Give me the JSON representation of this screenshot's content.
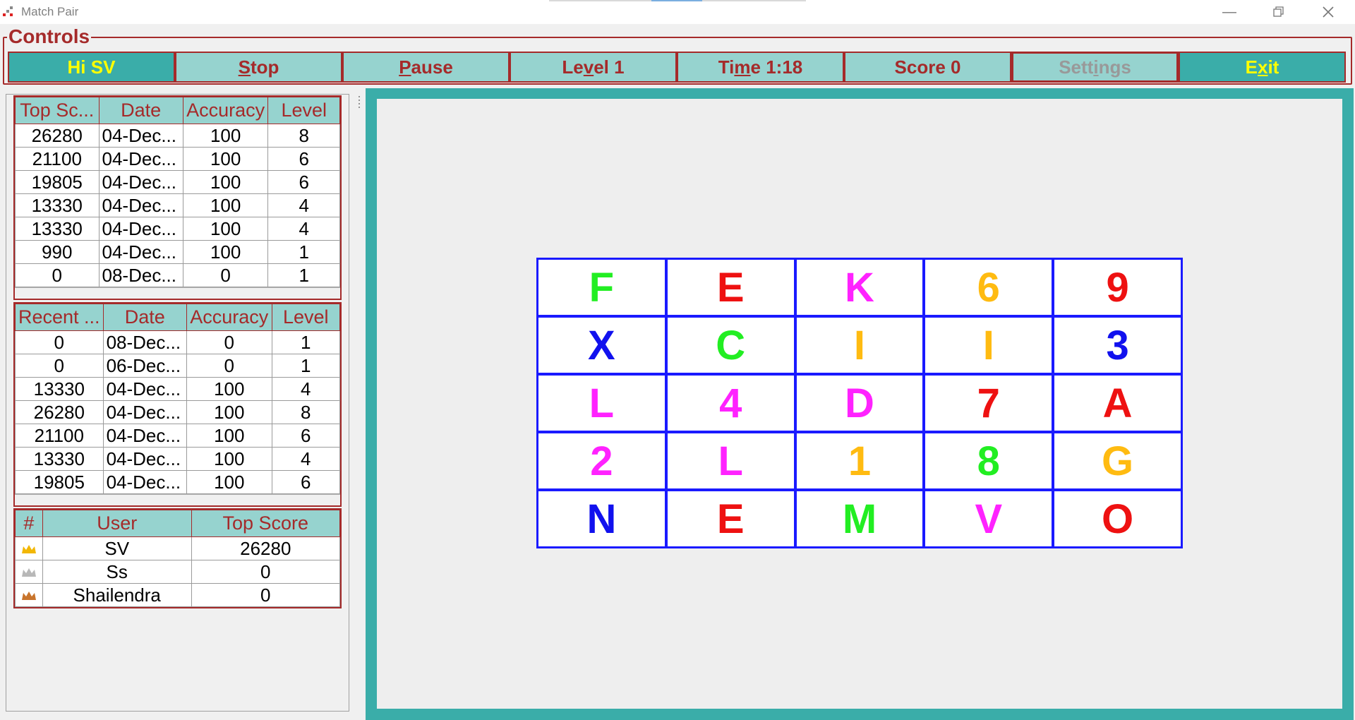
{
  "window": {
    "title": "Match Pair",
    "minimize_icon": "minimize-icon",
    "restore_icon": "restore-icon",
    "close_icon": "close-icon"
  },
  "controls": {
    "legend": "Controls",
    "buttons": [
      {
        "label": "Hi SV",
        "style": "teal"
      },
      {
        "label": "Stop",
        "style": "normal"
      },
      {
        "label": "Pause",
        "style": "normal"
      },
      {
        "label": "Level 1",
        "style": "normal"
      },
      {
        "label": "Time 1:18",
        "style": "normal"
      },
      {
        "label": "Score 0",
        "style": "normal"
      },
      {
        "label": "Settings",
        "style": "disabled"
      },
      {
        "label": "Exit",
        "style": "teal"
      }
    ]
  },
  "top_scores": {
    "headers": [
      "Top Sc...",
      "Date",
      "Accuracy",
      "Level"
    ],
    "rows": [
      [
        "26280",
        "04-Dec...",
        "100",
        "8"
      ],
      [
        "21100",
        "04-Dec...",
        "100",
        "6"
      ],
      [
        "19805",
        "04-Dec...",
        "100",
        "6"
      ],
      [
        "13330",
        "04-Dec...",
        "100",
        "4"
      ],
      [
        "13330",
        "04-Dec...",
        "100",
        "4"
      ],
      [
        "990",
        "04-Dec...",
        "100",
        "1"
      ],
      [
        "0",
        "08-Dec...",
        "0",
        "1"
      ]
    ]
  },
  "recent_scores": {
    "headers": [
      "Recent ...",
      "Date",
      "Accuracy",
      "Level"
    ],
    "rows": [
      [
        "0",
        "08-Dec...",
        "0",
        "1"
      ],
      [
        "0",
        "06-Dec...",
        "0",
        "1"
      ],
      [
        "13330",
        "04-Dec...",
        "100",
        "4"
      ],
      [
        "26280",
        "04-Dec...",
        "100",
        "8"
      ],
      [
        "21100",
        "04-Dec...",
        "100",
        "6"
      ],
      [
        "13330",
        "04-Dec...",
        "100",
        "4"
      ],
      [
        "19805",
        "04-Dec...",
        "100",
        "6"
      ]
    ]
  },
  "users": {
    "headers": [
      "#",
      "User",
      "Top Score"
    ],
    "rows": [
      {
        "crown": "gold-crown-icon",
        "crown_color": "#f2b705",
        "user": "SV",
        "score": "26280"
      },
      {
        "crown": "silver-crown-icon",
        "crown_color": "#b8b8b8",
        "user": "Ss",
        "score": "0"
      },
      {
        "crown": "bronze-crown-icon",
        "crown_color": "#c8742c",
        "user": "Shailendra",
        "score": "0"
      }
    ]
  },
  "board": {
    "accent": "#3aada9",
    "tiles": [
      {
        "ch": "F",
        "color": "#22ee22"
      },
      {
        "ch": "E",
        "color": "#ee1111"
      },
      {
        "ch": "K",
        "color": "#ff22ff"
      },
      {
        "ch": "6",
        "color": "#ffbb11"
      },
      {
        "ch": "9",
        "color": "#ee1111"
      },
      {
        "ch": "X",
        "color": "#1111ee"
      },
      {
        "ch": "C",
        "color": "#22ee22"
      },
      {
        "ch": "I",
        "color": "#ffbb11"
      },
      {
        "ch": "I",
        "color": "#ffbb11"
      },
      {
        "ch": "3",
        "color": "#1111ee"
      },
      {
        "ch": "L",
        "color": "#ff22ff"
      },
      {
        "ch": "4",
        "color": "#ff22ff"
      },
      {
        "ch": "D",
        "color": "#ff22ff"
      },
      {
        "ch": "7",
        "color": "#ee1111"
      },
      {
        "ch": "A",
        "color": "#ee1111"
      },
      {
        "ch": "2",
        "color": "#ff22ff"
      },
      {
        "ch": "L",
        "color": "#ff22ff"
      },
      {
        "ch": "1",
        "color": "#ffbb11"
      },
      {
        "ch": "8",
        "color": "#22ee22"
      },
      {
        "ch": "G",
        "color": "#ffbb11"
      },
      {
        "ch": "N",
        "color": "#1111ee"
      },
      {
        "ch": "E",
        "color": "#ee1111"
      },
      {
        "ch": "M",
        "color": "#22ee22"
      },
      {
        "ch": "V",
        "color": "#ff22ff"
      },
      {
        "ch": "O",
        "color": "#ee1111"
      }
    ]
  }
}
